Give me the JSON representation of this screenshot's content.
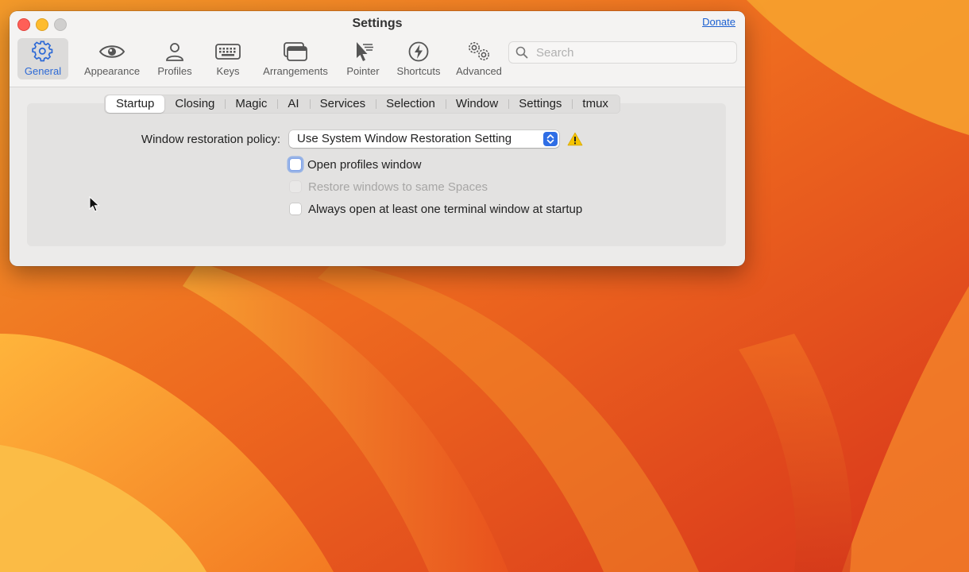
{
  "window": {
    "title": "Settings",
    "donate_label": "Donate"
  },
  "toolbar": {
    "items": [
      {
        "label": "General",
        "icon": "gear-icon",
        "selected": true
      },
      {
        "label": "Appearance",
        "icon": "eye-icon"
      },
      {
        "label": "Profiles",
        "icon": "person-icon"
      },
      {
        "label": "Keys",
        "icon": "keyboard-icon"
      },
      {
        "label": "Arrangements",
        "icon": "windows-icon"
      },
      {
        "label": "Pointer",
        "icon": "pointer-icon"
      },
      {
        "label": "Shortcuts",
        "icon": "bolt-icon"
      },
      {
        "label": "Advanced",
        "icon": "gears-icon"
      }
    ]
  },
  "search": {
    "placeholder": "Search",
    "value": ""
  },
  "tabs": {
    "items": [
      "Startup",
      "Closing",
      "Magic",
      "AI",
      "Services",
      "Selection",
      "Window",
      "Settings",
      "tmux"
    ],
    "active": "Startup"
  },
  "startup": {
    "policy_label": "Window restoration policy:",
    "policy_value": "Use System Window Restoration Setting",
    "checkboxes": [
      {
        "label": "Open profiles window",
        "checked": false,
        "enabled": true,
        "focused": true
      },
      {
        "label": "Restore windows to same Spaces",
        "checked": false,
        "enabled": false
      },
      {
        "label": "Always open at least one terminal window at startup",
        "checked": false,
        "enabled": true
      }
    ]
  },
  "colors": {
    "accent": "#2e6ad6",
    "popup_arrows": "#2f6ee5",
    "warning": "#f5c400",
    "close": "#ff5f57",
    "minimize": "#febc2e"
  }
}
